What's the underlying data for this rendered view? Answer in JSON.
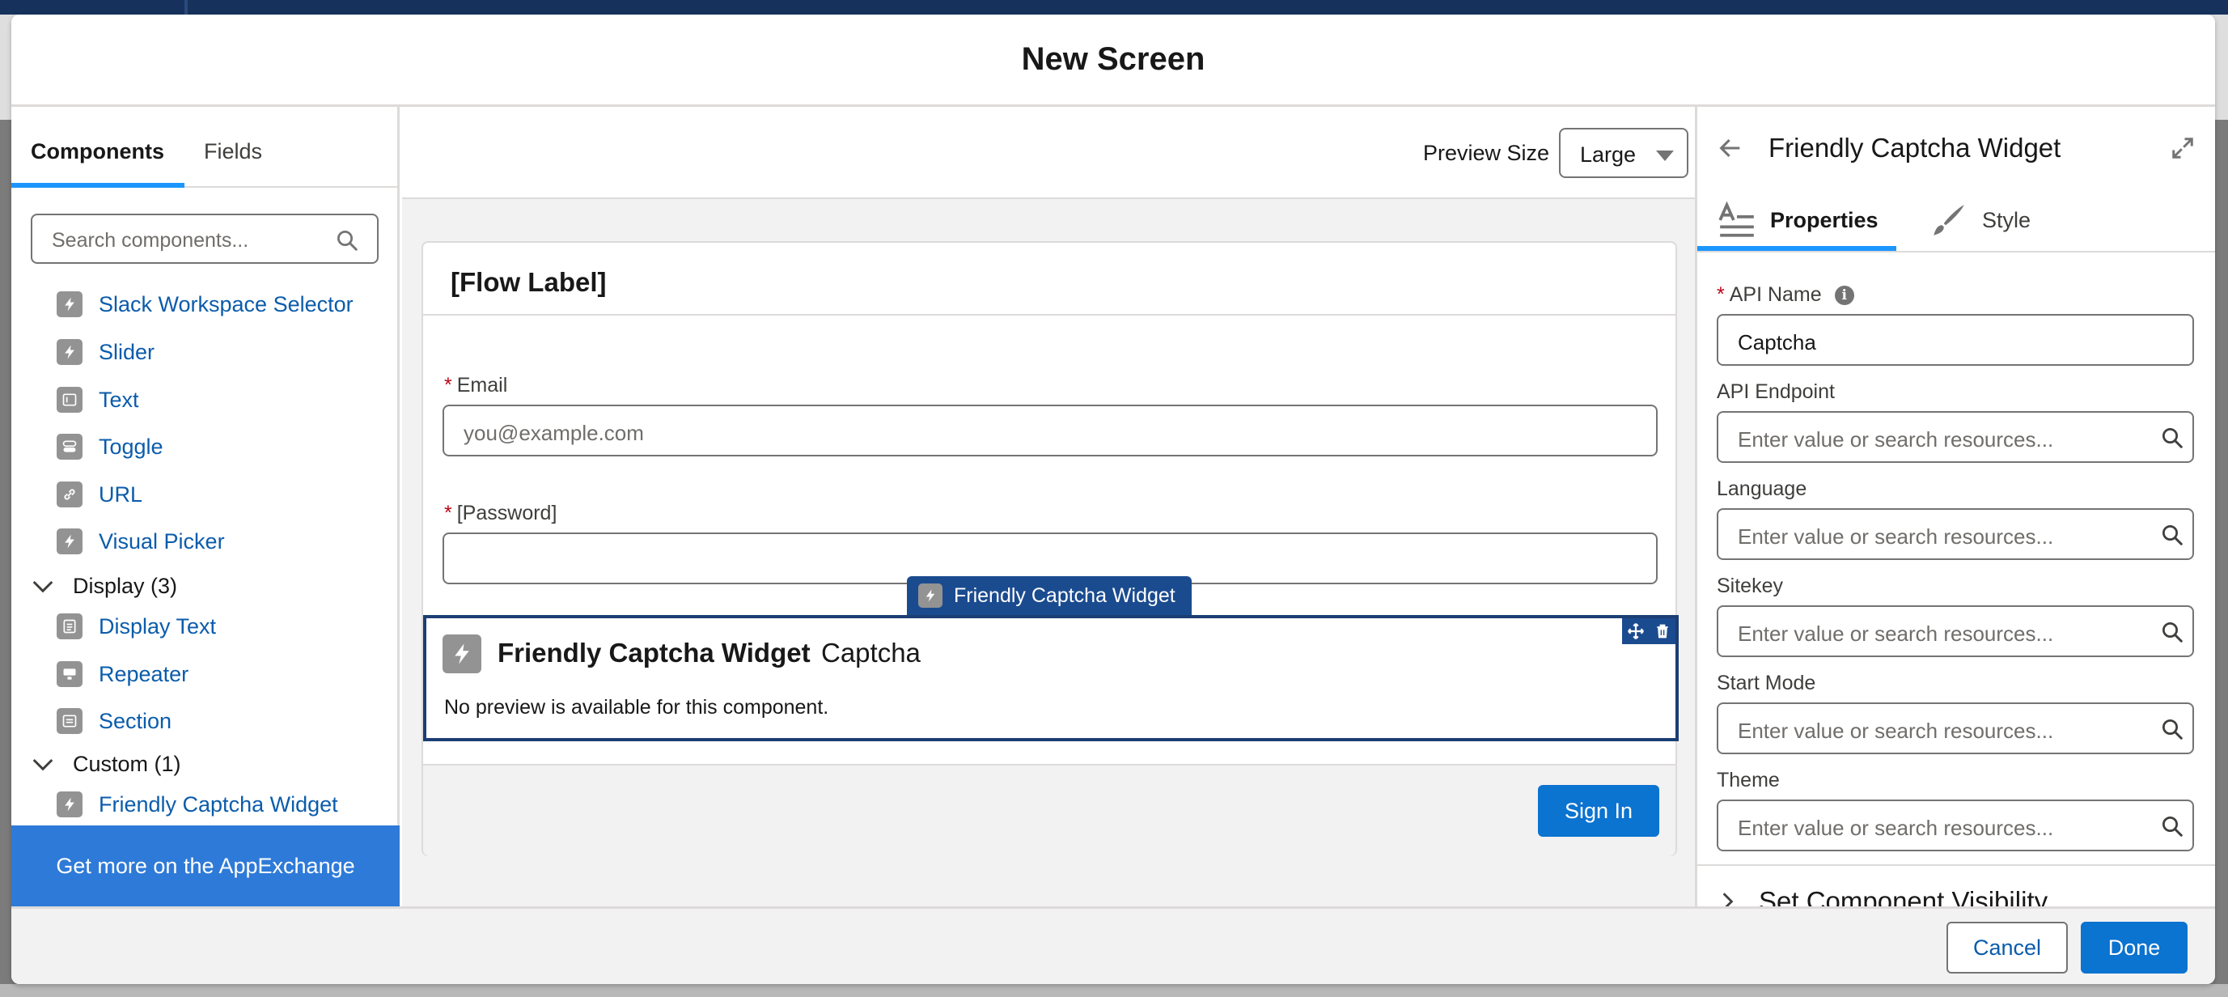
{
  "modal": {
    "title": "New Screen"
  },
  "left_panel": {
    "tabs": [
      {
        "label": "Components",
        "active": true
      },
      {
        "label": "Fields",
        "active": false
      }
    ],
    "search_placeholder": "Search components...",
    "items": [
      {
        "label": "Slack Workspace Selector",
        "icon": "lightning-icon"
      },
      {
        "label": "Slider",
        "icon": "lightning-icon"
      },
      {
        "label": "Text",
        "icon": "text-field-icon"
      },
      {
        "label": "Toggle",
        "icon": "toggle-icon"
      },
      {
        "label": "URL",
        "icon": "link-icon"
      },
      {
        "label": "Visual Picker",
        "icon": "lightning-icon"
      }
    ],
    "display_section": {
      "label": "Display (3)",
      "items": [
        {
          "label": "Display Text",
          "icon": "display-text-icon"
        },
        {
          "label": "Repeater",
          "icon": "repeater-icon"
        },
        {
          "label": "Section",
          "icon": "section-icon"
        }
      ]
    },
    "custom_section": {
      "label": "Custom (1)",
      "items": [
        {
          "label": "Friendly Captcha Widget",
          "icon": "lightning-icon"
        }
      ]
    },
    "appexchange_label": "Get more on the AppExchange"
  },
  "center": {
    "preview_size_label": "Preview Size",
    "preview_size_value": "Large",
    "flow_label": "[Flow Label]",
    "email": {
      "label": "Email",
      "placeholder": "you@example.com"
    },
    "password": {
      "label": "[Password]"
    },
    "widget": {
      "tag": "Friendly Captcha Widget",
      "title": "Friendly Captcha Widget",
      "api_name": "Captcha",
      "no_preview": "No preview is available for this component."
    },
    "sign_in_label": "Sign In"
  },
  "right_panel": {
    "title": "Friendly Captcha Widget",
    "tabs": [
      {
        "label": "Properties",
        "active": true
      },
      {
        "label": "Style",
        "active": false
      }
    ],
    "api_name": {
      "label": "API Name",
      "value": "Captcha"
    },
    "properties": [
      {
        "label": "API Endpoint",
        "placeholder": "Enter value or search resources..."
      },
      {
        "label": "Language",
        "placeholder": "Enter value or search resources..."
      },
      {
        "label": "Sitekey",
        "placeholder": "Enter value or search resources..."
      },
      {
        "label": "Start Mode",
        "placeholder": "Enter value or search resources..."
      },
      {
        "label": "Theme",
        "placeholder": "Enter value or search resources..."
      }
    ],
    "visibility_label": "Set Component Visibility"
  },
  "footer": {
    "cancel_label": "Cancel",
    "done_label": "Done"
  },
  "colors": {
    "brand_blue": "#0b73d0",
    "link_blue": "#0b5cab",
    "selection_navy": "#1b3e74",
    "required_red": "#ba0517"
  }
}
